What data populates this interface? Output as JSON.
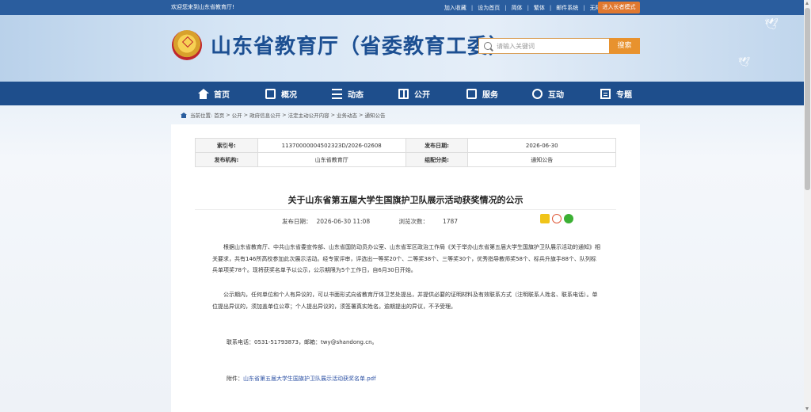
{
  "topbar": {
    "welcome": "欢迎您来到山东省教育厅!",
    "links": [
      "加入收藏",
      "设为首页",
      "简体",
      "繁体",
      "邮件系统",
      "无障碍浏览"
    ],
    "elder_mode": "进入长者模式"
  },
  "header": {
    "site_name": "山东省教育厅（省委教育工委）",
    "search_placeholder": "请输入关键词",
    "search_button": "搜索"
  },
  "nav": {
    "items": [
      {
        "label": "首页",
        "icon": "home-icon"
      },
      {
        "label": "概况",
        "icon": "overview-icon"
      },
      {
        "label": "动态",
        "icon": "news-icon"
      },
      {
        "label": "公开",
        "icon": "disclosure-icon"
      },
      {
        "label": "服务",
        "icon": "service-icon"
      },
      {
        "label": "互动",
        "icon": "interaction-icon"
      },
      {
        "label": "专题",
        "icon": "topic-icon"
      }
    ]
  },
  "breadcrumb": [
    "当前位置:",
    "首页",
    "公开",
    "政府信息公开",
    "法定主动公开内容",
    "业务动态",
    "通知公告"
  ],
  "meta": {
    "index_label": "索引号:",
    "index_value": "11370000004502323D/2026-02608",
    "date_label": "发布日期:",
    "date_value": "2026-06-30",
    "org_label": "发布机构:",
    "org_value": "山东省教育厅",
    "category_label": "组配分类:",
    "category_value": "通知公告"
  },
  "article": {
    "title": "关于山东省第五届大学生国旗护卫队展示活动获奖情况的公示",
    "publish_label": "发布日期：",
    "publish_value": "2026-06-30 11:08",
    "views_label": "浏览次数：",
    "views_value": "1787",
    "paragraph1": "根据山东省教育厅、中共山东省委宣传部、山东省国防动员办公室、山东省军区政治工作局《关于举办山东省第五届大学生国旗护卫队展示活动的通知》相关要求，共有146所高校参加此次展示活动。经专家评审，评选出一等奖20个、二等奖38个、三等奖30个，优秀指导教师奖58个、标兵升旗手88个、队列标兵单项奖78个。现将获奖名单予以公示，公示期限为5个工作日，自6月30日开始。",
    "paragraph2": "公示期内，任何单位和个人有异议的，可以书面形式向省教育厅体卫艺处提出，并提供必要的证明材料及有效联系方式（注明联系人姓名、联系电话）。单位提出异议的，须加盖单位公章；个人提出异议的，须签署真实姓名。逾期提出的异议，不予受理。",
    "contact": "联系电话：0531-51793873，邮箱：twy@shandong.cn。",
    "attachment_label": "附件：",
    "attachment_link": "山东省第五届大学生国旗护卫队展示活动获奖名单.pdf"
  },
  "colors": {
    "topbar": "#2a5d9e",
    "nav": "#1e4e8c",
    "accent": "#e8922e",
    "title": "#1c4f92"
  }
}
